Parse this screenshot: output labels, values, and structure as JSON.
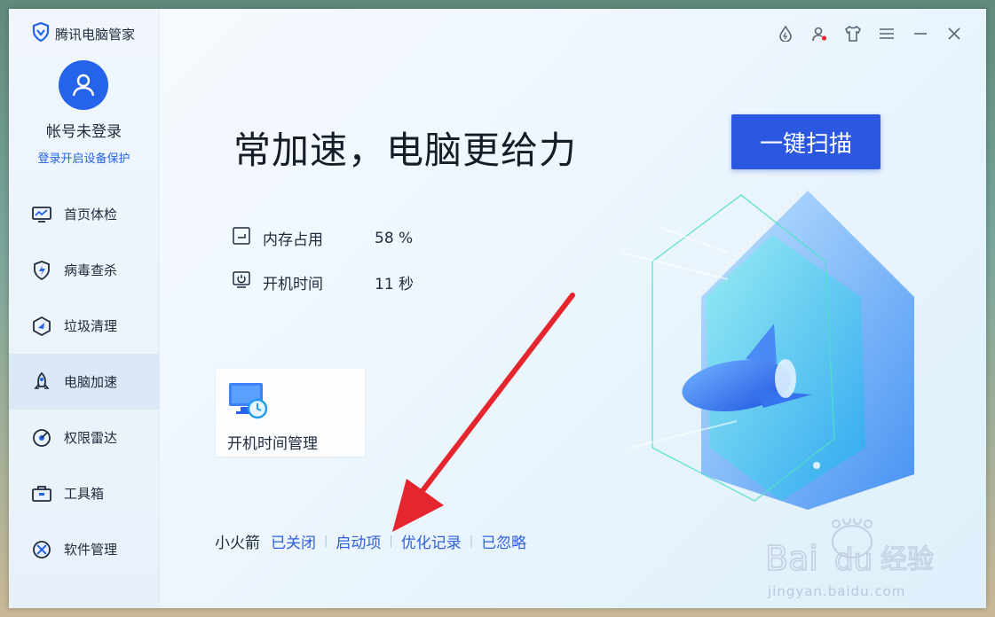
{
  "app": {
    "brand": "腾讯电脑管家"
  },
  "account": {
    "name": "帐号未登录",
    "login_link": "登录开启设备保护"
  },
  "nav": {
    "items": [
      {
        "label": "首页体检",
        "icon": "monitor-checkup-icon"
      },
      {
        "label": "病毒查杀",
        "icon": "shield-lightning-icon"
      },
      {
        "label": "垃圾清理",
        "icon": "broom-clean-icon"
      },
      {
        "label": "电脑加速",
        "icon": "rocket-icon",
        "active": true
      },
      {
        "label": "权限雷达",
        "icon": "radar-icon"
      },
      {
        "label": "工具箱",
        "icon": "toolbox-icon"
      },
      {
        "label": "软件管理",
        "icon": "software-grid-icon"
      }
    ]
  },
  "main": {
    "headline": "常加速，电脑更给力",
    "scan_button": "一键扫描",
    "stats": [
      {
        "label": "内存占用",
        "value": "58 %"
      },
      {
        "label": "开机时间",
        "value": "11 秒"
      }
    ],
    "card": {
      "title": "开机时间管理"
    },
    "bottom": {
      "label": "小火箭",
      "links": [
        "已关闭",
        "启动项",
        "优化记录",
        "已忽略"
      ]
    }
  },
  "watermark": {
    "text": "Bai du 经验",
    "url": "jingyan.baidu.com"
  },
  "colors": {
    "accent": "#2c57e0",
    "link": "#2f5fe0",
    "arrow": "#e5262f"
  }
}
